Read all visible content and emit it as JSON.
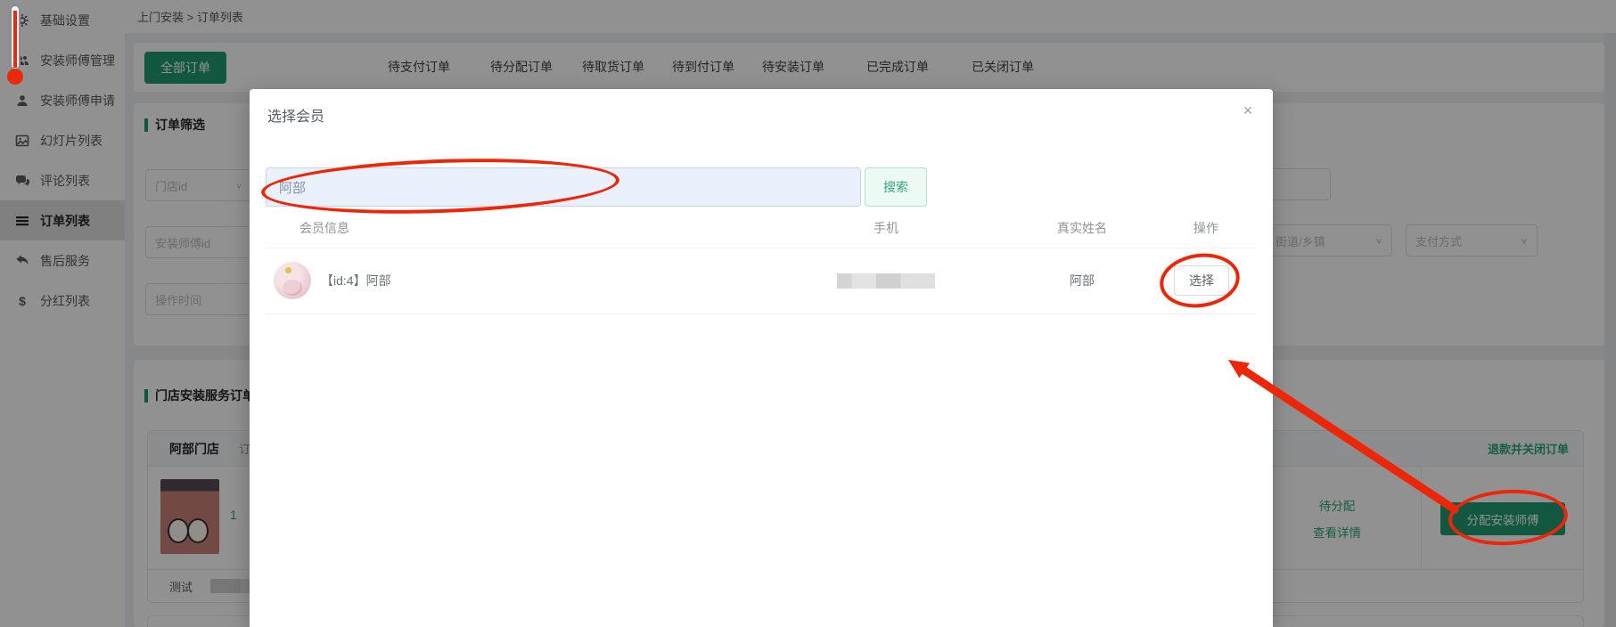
{
  "sidebar": {
    "items": [
      {
        "icon": "gear-icon",
        "label": "基础设置"
      },
      {
        "icon": "users-icon",
        "label": "安装师傅管理"
      },
      {
        "icon": "user-icon",
        "label": "安装师傅申请"
      },
      {
        "icon": "slides-icon",
        "label": "幻灯片列表"
      },
      {
        "icon": "comments-icon",
        "label": "评论列表"
      },
      {
        "icon": "list-icon",
        "label": "订单列表",
        "active": true
      },
      {
        "icon": "reply-icon",
        "label": "售后服务"
      },
      {
        "icon": "dollar-icon",
        "label": "分红列表"
      }
    ]
  },
  "breadcrumb": {
    "path": "上门安装 > 订单列表"
  },
  "tabs": {
    "active": "全部订单",
    "items": [
      "全部订单",
      "待支付订单",
      "待分配订单",
      "待取货订单",
      "待到付订单",
      "待安装订单",
      "已完成订单",
      "已关闭订单"
    ]
  },
  "filters": {
    "section_title": "订单筛选",
    "store_id_placeholder": "门店id",
    "installer_id_placeholder": "安装师傅id",
    "operate_time_placeholder": "操作时间",
    "street_placeholder": "街道/乡镇",
    "payment_placeholder": "支付方式"
  },
  "orders": {
    "section_title": "门店安装服务订单",
    "card": {
      "store_name": "阿部门店",
      "order_id_label": "订单ID",
      "refund_close_label": "退款并关闭订单",
      "quantity": "1",
      "status_label": "待分配",
      "view_detail_label": "查看详情",
      "assign_button_label": "分配安装师傅",
      "remark_label": "测试"
    }
  },
  "modal": {
    "title": "选择会员",
    "close_icon": "×",
    "search_value": "阿部",
    "search_button_label": "搜索",
    "columns": {
      "member_info": "会员信息",
      "phone": "手机",
      "real_name": "真实姓名",
      "action": "操作"
    },
    "member": {
      "info": "【id:4】阿部",
      "real_name": "阿部",
      "select_button_label": "选择"
    }
  },
  "colors": {
    "primary_green": "#219c72",
    "link_green": "#2aa876",
    "annotation_red": "#ee2609",
    "autofill_input_bg": "#e9f1fd",
    "overlay": "rgba(0,0,0,0.43)"
  }
}
